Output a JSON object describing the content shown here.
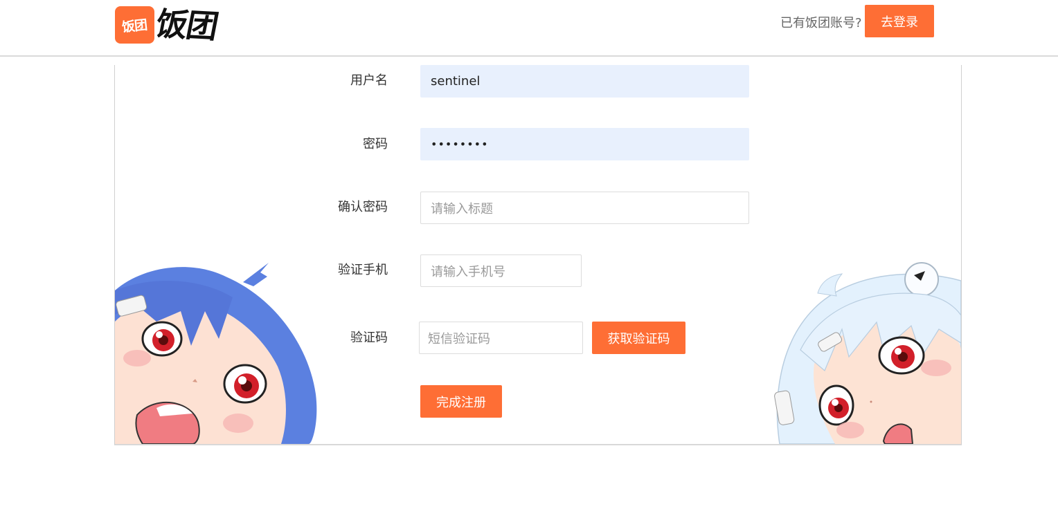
{
  "header": {
    "logo_badge_text": "饭团",
    "logo_text": "饭团",
    "have_account_text": "已有饭团账号?",
    "login_button": "去登录"
  },
  "form": {
    "username": {
      "label": "用户名",
      "value": "sentinel"
    },
    "password": {
      "label": "密码",
      "value": "••••••••"
    },
    "confirm_password": {
      "label": "确认密码",
      "placeholder": "请输入标题"
    },
    "phone": {
      "label": "验证手机",
      "placeholder": "请输入手机号"
    },
    "sms_code": {
      "label": "验证码",
      "placeholder": "短信验证码",
      "button": "获取验证码"
    },
    "submit_button": "完成注册"
  },
  "colors": {
    "accent": "#fe6e35",
    "autofill": "#e8f0fd",
    "left_character_hair": "#5a7fe0",
    "right_character_hair": "#dceefc"
  },
  "illustrations": {
    "left": "blue-haired-anime-girl",
    "right": "white-haired-anime-girl"
  }
}
